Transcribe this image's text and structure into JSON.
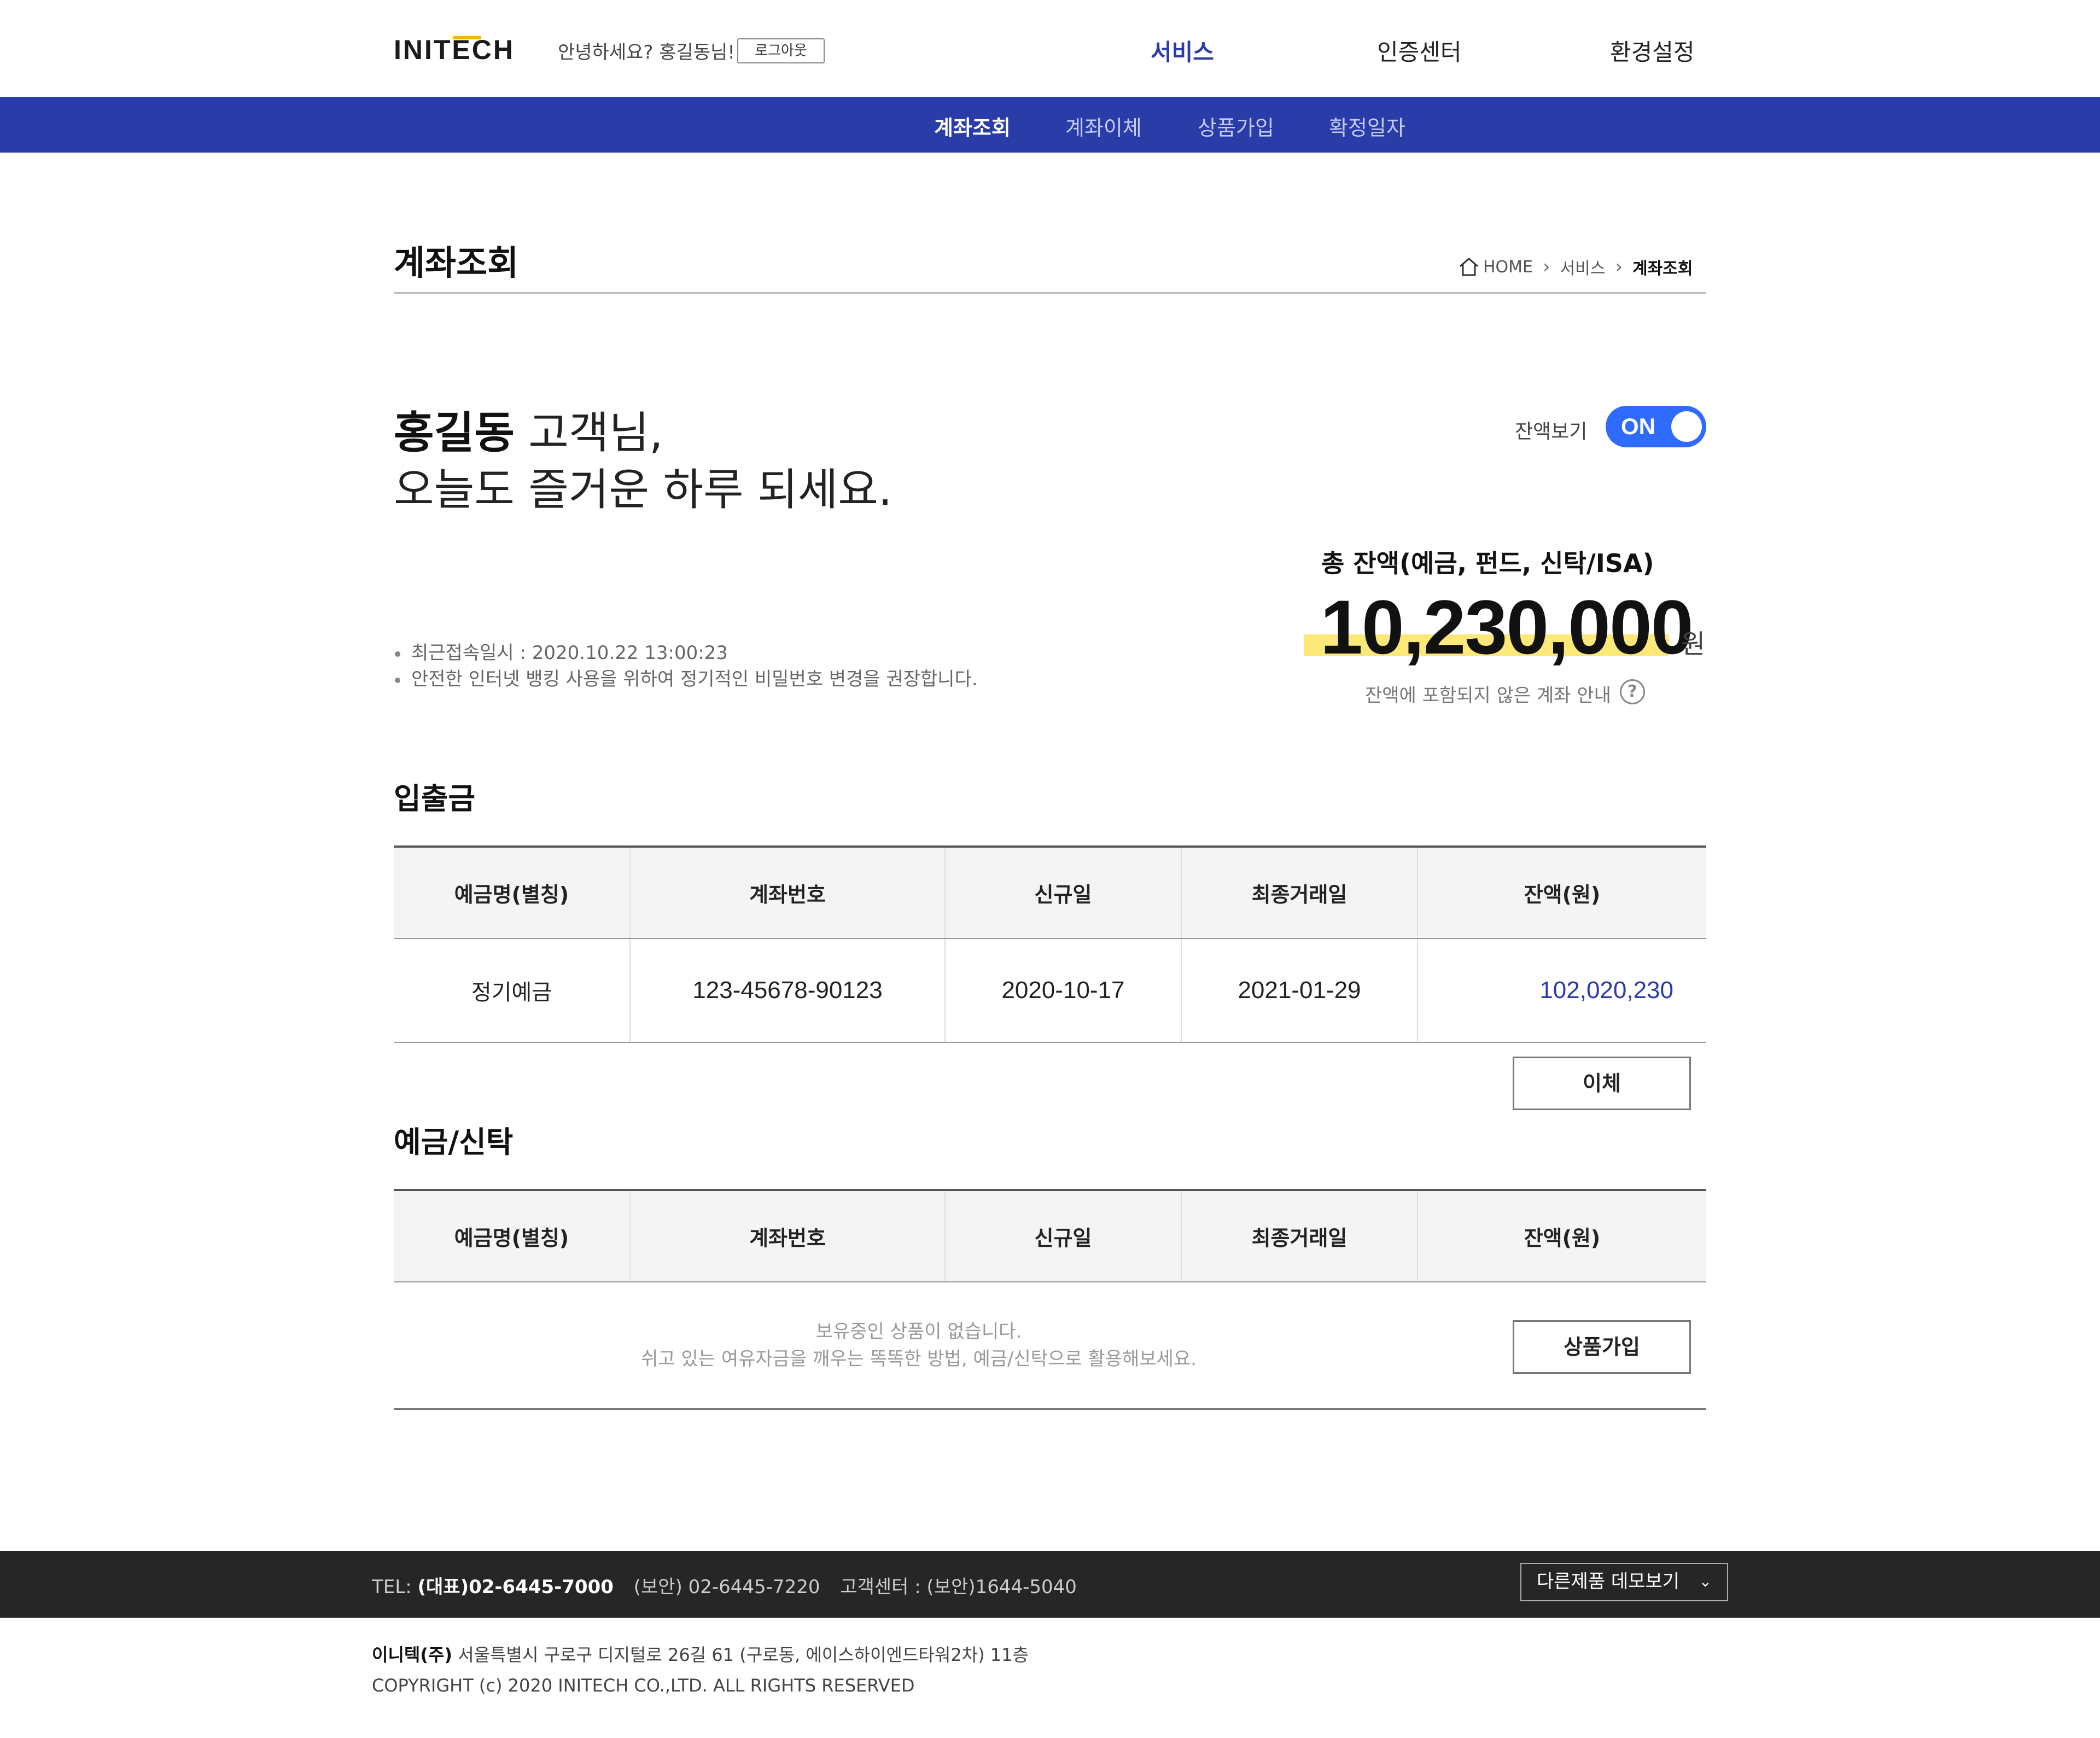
{
  "header": {
    "logo_text": "INITECH",
    "greeting": "안녕하세요? 홍길동님!",
    "logout_label": "로그아웃",
    "gnb": [
      {
        "label": "서비스",
        "active": true
      },
      {
        "label": "인증센터",
        "active": false
      },
      {
        "label": "환경설정",
        "active": false
      }
    ]
  },
  "subnav": [
    {
      "label": "계좌조회",
      "active": true
    },
    {
      "label": "계좌이체",
      "active": false
    },
    {
      "label": "상품가입",
      "active": false
    },
    {
      "label": "확정일자",
      "active": false
    }
  ],
  "page": {
    "title": "계좌조회",
    "breadcrumb": [
      "HOME",
      "서비스",
      "계좌조회"
    ]
  },
  "greeting": {
    "name": "홍길동",
    "suffix": " 고객님,",
    "line2": "오늘도 즐거운 하루 되세요."
  },
  "notes": [
    "최근접속일시 : 2020.10.22 13:00:23",
    "안전한 인터넷 뱅킹 사용을 위하여 정기적인 비밀번호 변경을 권장합니다."
  ],
  "balance": {
    "toggle_label": "잔액보기",
    "toggle_state": "ON",
    "total_label": "총 잔액(예금, 펀드, 신탁/ISA)",
    "total_amount": "10,230,000",
    "unit": "원",
    "exclusion_info": "잔액에 포함되지 않은 계좌 안내",
    "help_glyph": "?"
  },
  "deposit_section": {
    "title": "입출금",
    "columns": [
      "예금명(별칭)",
      "계좌번호",
      "신규일",
      "최종거래일",
      "잔액(원)"
    ],
    "rows": [
      {
        "name": "정기예금",
        "account": "123-45678-90123",
        "opened": "2020-10-17",
        "last_tx": "2021-01-29",
        "balance": "102,020,230"
      }
    ],
    "action_label": "이체"
  },
  "trust_section": {
    "title": "예금/신탁",
    "columns": [
      "예금명(별칭)",
      "계좌번호",
      "신규일",
      "최종거래일",
      "잔액(원)"
    ],
    "empty_line1": "보유중인 상품이 없습니다.",
    "empty_line2": "쉬고 있는 여유자금을 깨우는 똑똑한 방법, 예금/신탁으로 활용해보세요.",
    "action_label": "상품가입"
  },
  "footer": {
    "tel_prefix": "TEL:",
    "tel_main": "(대표)02-6445-7000",
    "tel_security": "(보안) 02-6445-7220",
    "customer_center": "고객센터 : (보안)1644-5040",
    "demo_label": "다른제품 데모보기",
    "company": "이니텍(주)",
    "address": " 서울특별시 구로구 디지털로 26길 61 (구로동, 에이스하이엔드타워2차) 11층",
    "copyright": "COPYRIGHT (c) 2020 INITECH CO.,LTD. ALL RIGHTS RESERVED"
  },
  "colors": {
    "brand_blue": "#2a3ca8",
    "toggle_blue": "#2f6bff",
    "highlight_yellow": "#fde97a",
    "footer_dark": "#262626"
  },
  "icons": [
    "home-icon",
    "chevron-right-icon",
    "help-icon",
    "chevron-down-icon"
  ]
}
